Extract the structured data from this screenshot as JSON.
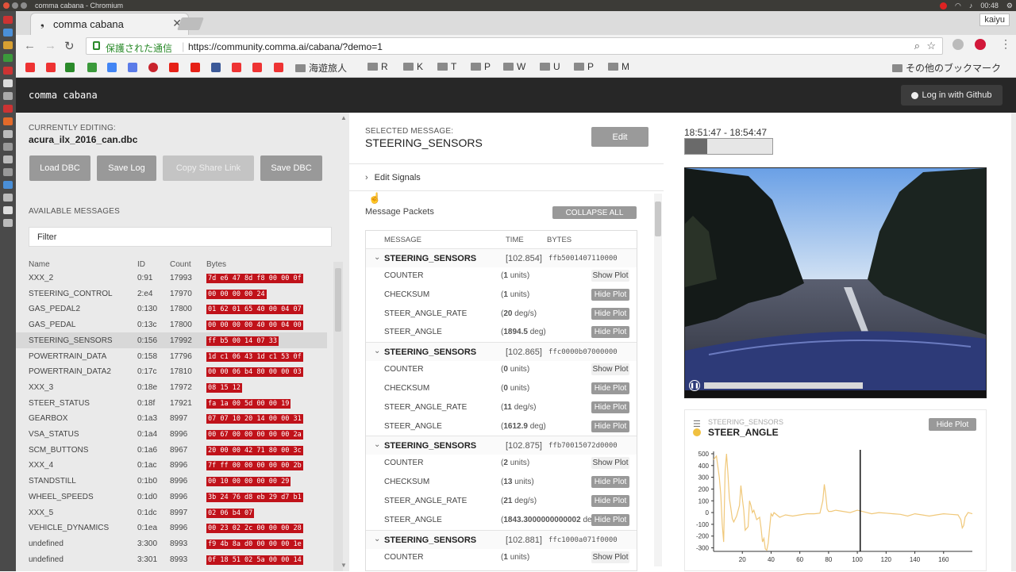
{
  "os": {
    "window_title": "comma cabana - Chromium",
    "clock": "00:48",
    "user": "kaiyu"
  },
  "browser": {
    "tab_title": "comma cabana",
    "secure_label": "保護された通信",
    "url": "https://community.comma.ai/cabana/?demo=1",
    "bookmark_folders": [
      "海遊旅人",
      "R",
      "K",
      "T",
      "P",
      "W",
      "U",
      "P",
      "M"
    ],
    "other_bookmarks": "その他のブックマーク"
  },
  "app": {
    "brand": "comma cabana",
    "login_label": "Log in with Github"
  },
  "left": {
    "editing_caption": "CURRENTLY EDITING:",
    "dbc_file": "acura_ilx_2016_can.dbc",
    "buttons": {
      "load": "Load DBC",
      "save_log": "Save Log",
      "share": "Copy Share Link",
      "save_dbc": "Save DBC"
    },
    "available_caption": "AVAILABLE MESSAGES",
    "filter_placeholder": "Filter",
    "columns": {
      "name": "Name",
      "id": "ID",
      "count": "Count",
      "bytes": "Bytes"
    },
    "messages": [
      {
        "name": "XXX_2",
        "id": "0:91",
        "count": "17993",
        "bytes": "7d e6 47 8d f8 00 00 0f"
      },
      {
        "name": "STEERING_CONTROL",
        "id": "2:e4",
        "count": "17970",
        "bytes": "00 00 00 00 24"
      },
      {
        "name": "GAS_PEDAL2",
        "id": "0:130",
        "count": "17800",
        "bytes": "01 62 01 65 40 00 04 07"
      },
      {
        "name": "GAS_PEDAL",
        "id": "0:13c",
        "count": "17800",
        "bytes": "00 00 00 00 40 00 04 00"
      },
      {
        "name": "STEERING_SENSORS",
        "id": "0:156",
        "count": "17992",
        "bytes": "ff b5 00 14 07 33"
      },
      {
        "name": "POWERTRAIN_DATA",
        "id": "0:158",
        "count": "17796",
        "bytes": "1d c1 06 43 1d c1 53 0f"
      },
      {
        "name": "POWERTRAIN_DATA2",
        "id": "0:17c",
        "count": "17810",
        "bytes": "00 00 06 b4 80 00 00 03"
      },
      {
        "name": "XXX_3",
        "id": "0:18e",
        "count": "17972",
        "bytes": "08 15 12"
      },
      {
        "name": "STEER_STATUS",
        "id": "0:18f",
        "count": "17921",
        "bytes": "fa 1a 00 5d 00 00 19"
      },
      {
        "name": "GEARBOX",
        "id": "0:1a3",
        "count": "8997",
        "bytes": "07 07 10 20 14 00 00 31"
      },
      {
        "name": "VSA_STATUS",
        "id": "0:1a4",
        "count": "8996",
        "bytes": "00 67 00 00 00 00 00 2a"
      },
      {
        "name": "SCM_BUTTONS",
        "id": "0:1a6",
        "count": "8967",
        "bytes": "20 00 00 42 71 80 00 3c"
      },
      {
        "name": "XXX_4",
        "id": "0:1ac",
        "count": "8996",
        "bytes": "7f ff 00 00 00 00 00 2b"
      },
      {
        "name": "STANDSTILL",
        "id": "0:1b0",
        "count": "8996",
        "bytes": "00 10 00 00 00 00 29"
      },
      {
        "name": "WHEEL_SPEEDS",
        "id": "0:1d0",
        "count": "8996",
        "bytes": "3b 24 76 d8 eb 29 d7 b1"
      },
      {
        "name": "XXX_5",
        "id": "0:1dc",
        "count": "8997",
        "bytes": "02 06 b4 07"
      },
      {
        "name": "VEHICLE_DYNAMICS",
        "id": "0:1ea",
        "count": "8996",
        "bytes": "00 23 02 2c 00 00 00 28"
      },
      {
        "name": "undefined",
        "id": "3:300",
        "count": "8993",
        "bytes": "f9 4b 8a d0 00 00 00 1e"
      },
      {
        "name": "undefined",
        "id": "3:301",
        "count": "8993",
        "bytes": "0f 18 51 02 5a 00 00 14"
      }
    ]
  },
  "middle": {
    "selected_caption": "SELECTED MESSAGE:",
    "selected_name": "STEERING_SENSORS",
    "edit_label": "Edit",
    "edit_signals": "Edit Signals",
    "packets_title": "Message Packets",
    "collapse_label": "COLLAPSE ALL",
    "columns": {
      "message": "MESSAGE",
      "time": "TIME",
      "bytes": "BYTES"
    },
    "packets": [
      {
        "name": "STEERING_SENSORS",
        "time": "[102.854]",
        "hex": "ffb5001407110000",
        "signals": [
          {
            "name": "COUNTER",
            "value": "1",
            "unit": "units",
            "button": "Show Plot"
          },
          {
            "name": "CHECKSUM",
            "value": "1",
            "unit": "units",
            "button": "Hide Plot"
          },
          {
            "name": "STEER_ANGLE_RATE",
            "value": "20",
            "unit": "deg/s",
            "button": "Hide Plot"
          },
          {
            "name": "STEER_ANGLE",
            "value": "1894.5",
            "unit": "deg",
            "button": "Hide Plot"
          }
        ]
      },
      {
        "name": "STEERING_SENSORS",
        "time": "[102.865]",
        "hex": "ffc0000b07000000",
        "signals": [
          {
            "name": "COUNTER",
            "value": "0",
            "unit": "units",
            "button": "Show Plot"
          },
          {
            "name": "CHECKSUM",
            "value": "0",
            "unit": "units",
            "button": "Hide Plot"
          },
          {
            "name": "STEER_ANGLE_RATE",
            "value": "11",
            "unit": "deg/s",
            "button": "Hide Plot"
          },
          {
            "name": "STEER_ANGLE",
            "value": "1612.9",
            "unit": "deg",
            "button": "Hide Plot"
          }
        ]
      },
      {
        "name": "STEERING_SENSORS",
        "time": "[102.875]",
        "hex": "ffb70015072d0000",
        "signals": [
          {
            "name": "COUNTER",
            "value": "2",
            "unit": "units",
            "button": "Show Plot"
          },
          {
            "name": "CHECKSUM",
            "value": "13",
            "unit": "units",
            "button": "Hide Plot"
          },
          {
            "name": "STEER_ANGLE_RATE",
            "value": "21",
            "unit": "deg/s",
            "button": "Hide Plot"
          },
          {
            "name": "STEER_ANGLE",
            "value": "1843.3000000000002",
            "unit": "deg",
            "button": "Hide Plot"
          }
        ]
      },
      {
        "name": "STEERING_SENSORS",
        "time": "[102.881]",
        "hex": "ffc1000a071f0000",
        "signals": [
          {
            "name": "COUNTER",
            "value": "1",
            "unit": "units",
            "button": "Show Plot"
          }
        ]
      }
    ]
  },
  "right": {
    "time_range": "18:51:47 - 18:54:47",
    "time_progress": 0.25,
    "video_progress": 0.0,
    "plot": {
      "message": "STEERING_SENSORS",
      "signal": "STEER_ANGLE",
      "button": "Hide Plot"
    }
  },
  "chart_data": {
    "type": "line",
    "series": [
      {
        "name": "STEER_ANGLE",
        "x": [
          0,
          2,
          4,
          5,
          6,
          7,
          8,
          9,
          10,
          11,
          12,
          13,
          14,
          16,
          18,
          19,
          20,
          21,
          22,
          24,
          25,
          26,
          27,
          28,
          30,
          32,
          33,
          34,
          35,
          36,
          37,
          38,
          39,
          40,
          41,
          42,
          44,
          46,
          48,
          50,
          55,
          60,
          65,
          70,
          74,
          76,
          77,
          78,
          79,
          80,
          82,
          85,
          90,
          95,
          100,
          105,
          110,
          115,
          120,
          125,
          130,
          135,
          140,
          145,
          150,
          155,
          160,
          165,
          170,
          172,
          173,
          174,
          175,
          176,
          177,
          180
        ],
        "y": [
          450,
          480,
          300,
          150,
          -100,
          -250,
          350,
          500,
          330,
          120,
          40,
          -50,
          -80,
          -30,
          60,
          230,
          120,
          20,
          -150,
          -120,
          100,
          60,
          0,
          20,
          -60,
          -40,
          -130,
          -250,
          -220,
          -310,
          -320,
          -260,
          -130,
          -10,
          -30,
          0,
          -20,
          -40,
          -30,
          -20,
          -30,
          -20,
          -10,
          -10,
          -5,
          100,
          240,
          150,
          30,
          10,
          10,
          20,
          10,
          0,
          20,
          5,
          -10,
          0,
          -5,
          -10,
          -15,
          -30,
          -10,
          -20,
          -30,
          -20,
          -10,
          -15,
          -20,
          -60,
          -130,
          -110,
          -40,
          -20,
          0,
          -10
        ]
      }
    ],
    "xlim": [
      0,
      180
    ],
    "ylim": [
      -330,
      520
    ],
    "xticks": [
      20,
      40,
      60,
      80,
      100,
      120,
      140,
      160
    ],
    "yticks": [
      500,
      400,
      300,
      200,
      100,
      0,
      -100,
      -200,
      -300
    ],
    "cursor_x": 102,
    "color": "#f0c87a"
  }
}
